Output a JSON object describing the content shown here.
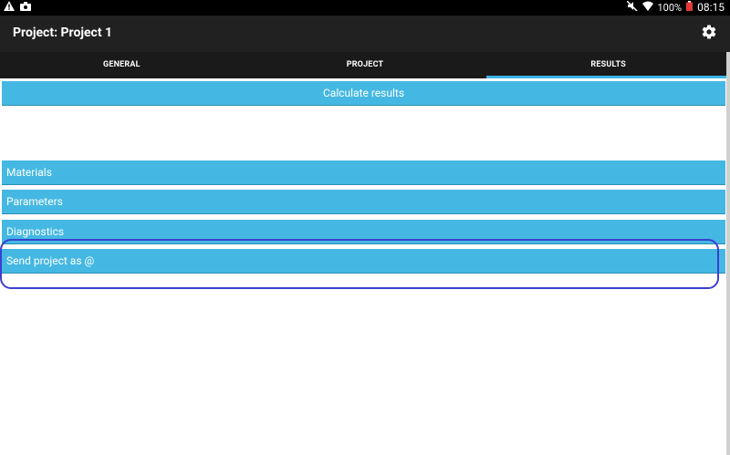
{
  "status_bar": {
    "battery": "100%",
    "time": "08:15"
  },
  "app_bar": {
    "title": "Project: Project 1"
  },
  "tabs": [
    {
      "label": "GENERAL",
      "active": false
    },
    {
      "label": "PROJECT",
      "active": false
    },
    {
      "label": "RESULTS",
      "active": true
    }
  ],
  "main": {
    "calculate_label": "Calculate results",
    "sections": [
      {
        "label": "Materials"
      },
      {
        "label": "Parameters"
      },
      {
        "label": "Diagnostics"
      },
      {
        "label": "Send project as @"
      }
    ]
  },
  "colors": {
    "accent": "#44b8e2",
    "highlight": "#3a3fd0",
    "appbar": "#212121"
  }
}
